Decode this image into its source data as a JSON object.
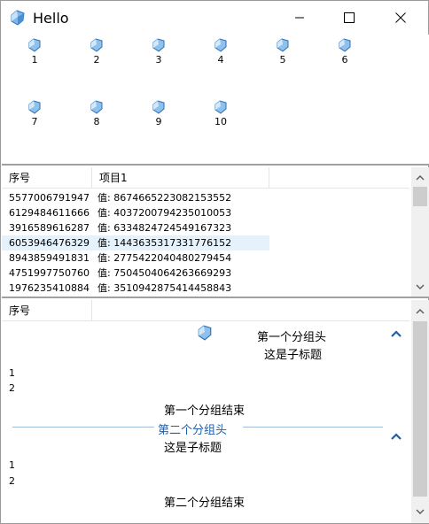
{
  "window": {
    "title": "Hello",
    "accent": "#2b6cb0"
  },
  "icons": {
    "items": [
      {
        "label": "1"
      },
      {
        "label": "2"
      },
      {
        "label": "3"
      },
      {
        "label": "4"
      },
      {
        "label": "5"
      },
      {
        "label": "6"
      },
      {
        "label": "7"
      },
      {
        "label": "8"
      },
      {
        "label": "9"
      },
      {
        "label": "10"
      }
    ],
    "icon_name": "gem-icon"
  },
  "list1": {
    "columns": [
      "序号",
      "项目1"
    ],
    "rows": [
      {
        "id": "5577006791947...",
        "value": "值: 8674665223082153552"
      },
      {
        "id": "6129484611666...",
        "value": "值: 4037200794235010053"
      },
      {
        "id": "3916589616287...",
        "value": "值: 6334824724549167323"
      },
      {
        "id": "6053946476329...",
        "value": "值: 1443635317331776152"
      },
      {
        "id": "8943859491831...",
        "value": "值: 2775422040480279454"
      },
      {
        "id": "4751997750760...",
        "value": "值: 7504504064263669293"
      },
      {
        "id": "1976235410884...",
        "value": "值: 3510942875414458843"
      }
    ],
    "selected_row": 3
  },
  "grouped": {
    "column": "序号",
    "group1": {
      "header": "第一个分组头",
      "subtitle": "这是子标题",
      "items": [
        "1",
        "2"
      ],
      "footer": "第一个分组结束"
    },
    "group2": {
      "header": "第二个分组头",
      "subtitle": "这是子标题",
      "items": [
        "1",
        "2"
      ],
      "footer": "第二个分组结束"
    }
  }
}
